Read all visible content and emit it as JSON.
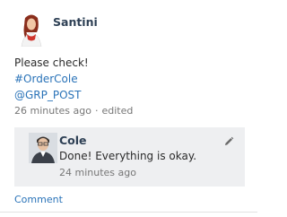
{
  "post": {
    "author": "Santini",
    "message": "Please check!",
    "hashtag": "#OrderCole",
    "mention": "@GRP_POST",
    "time": "26 minutes ago",
    "separator": "·",
    "edited": "edited"
  },
  "reply": {
    "author": "Cole",
    "message": "Done! Everything is okay.",
    "time": "24 minutes ago"
  },
  "actions": {
    "comment_label": "Comment"
  },
  "colors": {
    "name": "#2d3f54",
    "link": "#2a73b8",
    "reply_bg": "#eeeff1"
  },
  "icons": {
    "edit": "pencil-icon"
  }
}
